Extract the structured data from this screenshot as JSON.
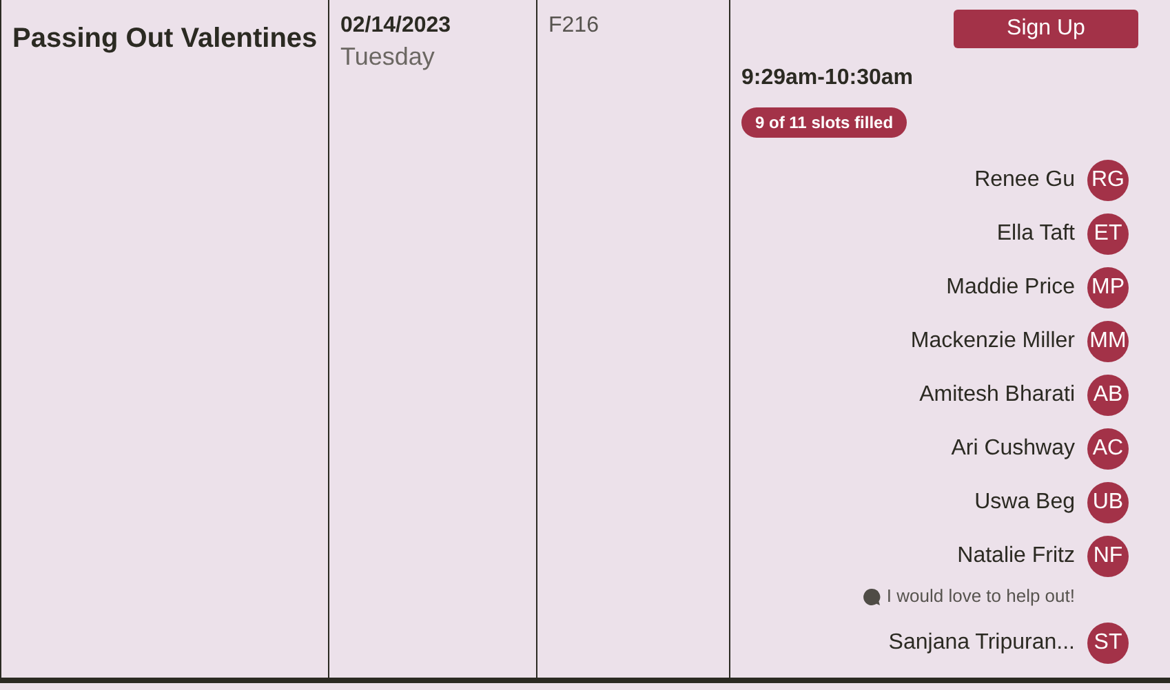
{
  "activity": {
    "title": "Passing Out Valentines"
  },
  "date": {
    "date": "02/14/2023",
    "weekday": "Tuesday"
  },
  "location": "F216",
  "slot": {
    "button": "Sign Up",
    "time": "9:29am-10:30am",
    "badge": "9 of 11 slots filled",
    "volunteers": [
      {
        "name": "Renee Gu",
        "initials": "RG"
      },
      {
        "name": "Ella Taft",
        "initials": "ET"
      },
      {
        "name": "Maddie Price",
        "initials": "MP"
      },
      {
        "name": "Mackenzie Miller",
        "initials": "MM"
      },
      {
        "name": "Amitesh Bharati",
        "initials": "AB"
      },
      {
        "name": "Ari Cushway",
        "initials": "AC"
      },
      {
        "name": "Uswa Beg",
        "initials": "UB"
      },
      {
        "name": "Natalie Fritz",
        "initials": "NF",
        "comment": "I would love to help out!"
      },
      {
        "name": "Sanjana Tripuran...",
        "initials": "ST"
      }
    ]
  }
}
